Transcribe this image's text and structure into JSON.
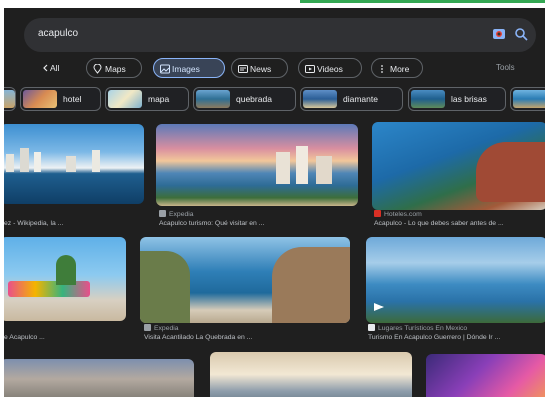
{
  "search": {
    "query": "acapulco"
  },
  "tabs": [
    {
      "label": "All",
      "icon": "back-arrow-icon"
    },
    {
      "label": "Maps",
      "icon": "map-pin-icon"
    },
    {
      "label": "Images",
      "icon": "image-icon",
      "active": true
    },
    {
      "label": "News",
      "icon": "news-icon"
    },
    {
      "label": "Videos",
      "icon": "video-icon"
    },
    {
      "label": "More",
      "icon": "more-icon"
    }
  ],
  "tools_label": "Tools",
  "chips": [
    {
      "label": "hotel"
    },
    {
      "label": "mapa"
    },
    {
      "label": "quebrada"
    },
    {
      "label": "diamante"
    },
    {
      "label": "las brisas"
    }
  ],
  "results": [
    {
      "source": "",
      "caption": "ez - Wikipedia, la ..."
    },
    {
      "source": "Expedia",
      "caption": "Acapulco turismo: Qué visitar en ..."
    },
    {
      "source": "Hoteles.com",
      "caption": "Acapulco - Lo que debes saber antes de ..."
    },
    {
      "source": "",
      "caption": "e Acapulco ..."
    },
    {
      "source": "Expedia",
      "caption": "Visita Acantilado La Quebrada en ..."
    },
    {
      "source": "Lugares Turísticos En Mexico",
      "caption": "Turismo En Acapulco Guerrero | Dónde Ir ..."
    }
  ],
  "colors": {
    "background": "#1f1f1f",
    "searchbar": "#303134",
    "active_tab": "#394457",
    "accent": "#8ab4f8"
  }
}
